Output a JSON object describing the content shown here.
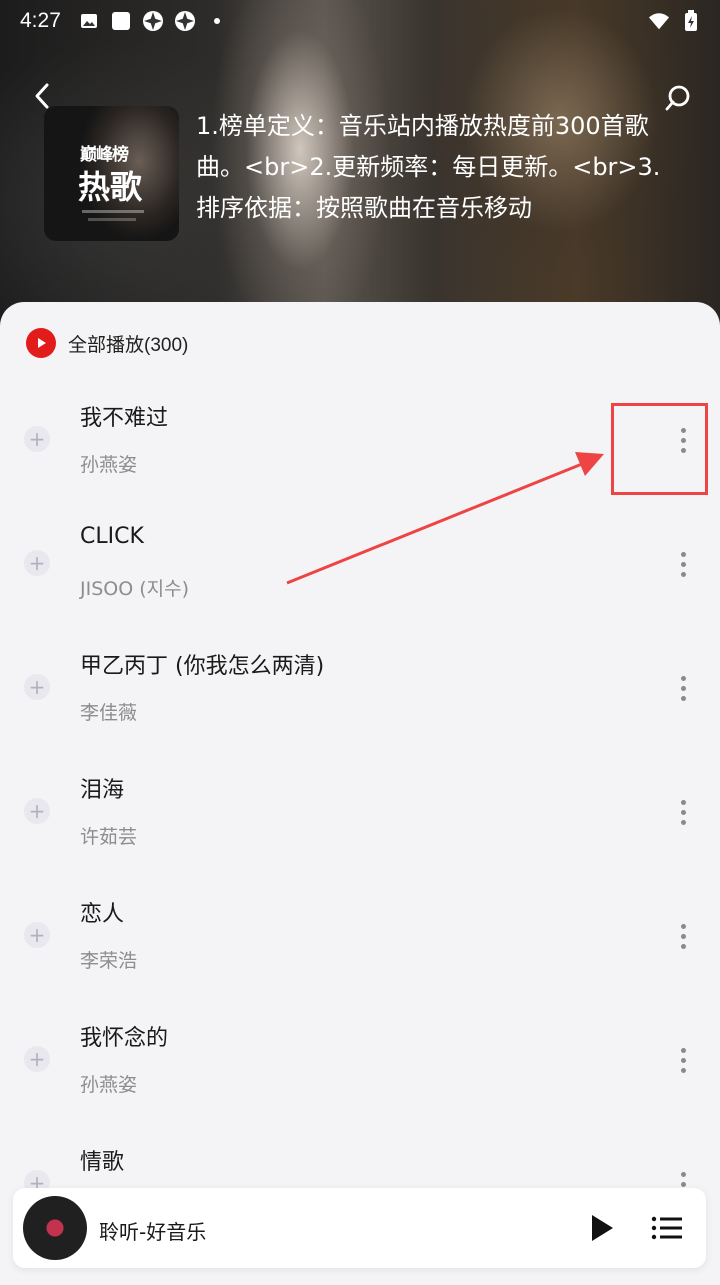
{
  "status_bar": {
    "time": "4:27",
    "left_icons": [
      "image-icon",
      "square-app-icon",
      "aperture-icon",
      "aperture-icon",
      "dot-icon"
    ],
    "right_icons": [
      "wifi-icon",
      "battery-charging-icon"
    ]
  },
  "header": {
    "cover": {
      "subtitle": "巅峰榜",
      "title": "热歌"
    },
    "description": "1.榜单定义：音乐站内播放热度前300首歌曲。<br>2.更新频率：每日更新。<br>3.排序依据：按照歌曲在音乐移动"
  },
  "play_all": {
    "label": "全部播放(300)"
  },
  "songs": [
    {
      "title": "我不难过",
      "artist": "孙燕姿"
    },
    {
      "title": "CLICK",
      "artist": "JISOO (지수)"
    },
    {
      "title": "甲乙丙丁 (你我怎么两清)",
      "artist": "李佳薇"
    },
    {
      "title": "泪海",
      "artist": "许茹芸"
    },
    {
      "title": "恋人",
      "artist": "李荣浩"
    },
    {
      "title": "我怀念的",
      "artist": "孙燕姿"
    },
    {
      "title": "情歌",
      "artist": ""
    }
  ],
  "player": {
    "title": "聆听-好音乐"
  },
  "colors": {
    "accent_red": "#e21b1b",
    "annotation_red": "#ee4444",
    "panel_bg": "#f4f4f6"
  }
}
